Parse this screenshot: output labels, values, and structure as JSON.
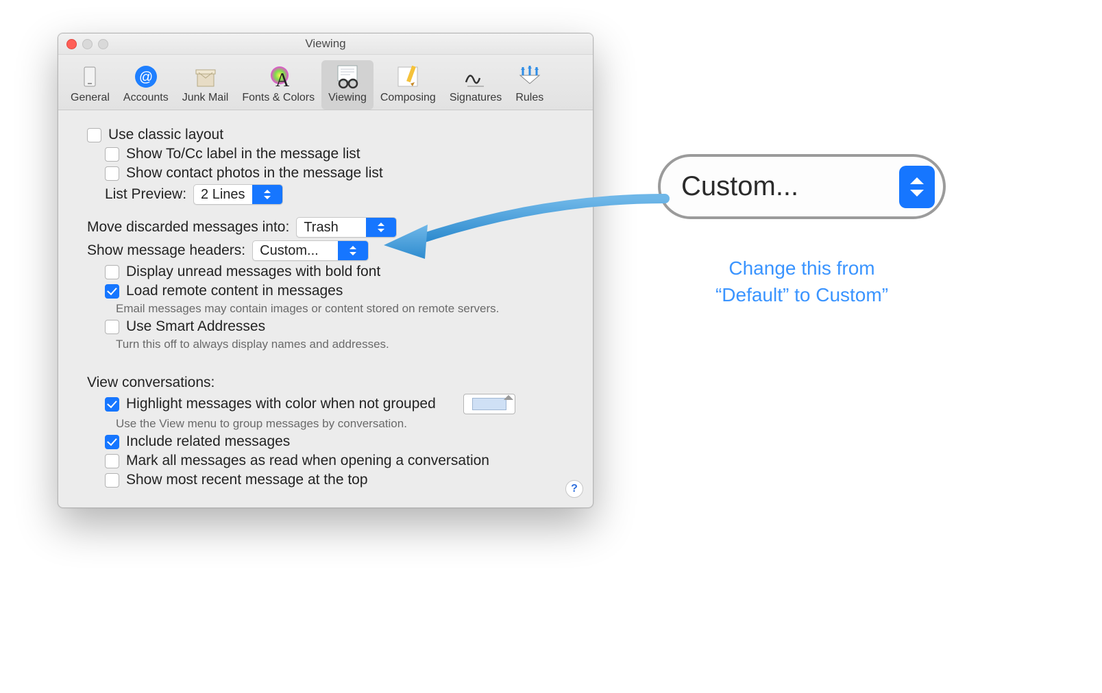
{
  "window": {
    "title": "Viewing",
    "tabs": [
      "General",
      "Accounts",
      "Junk Mail",
      "Fonts & Colors",
      "Viewing",
      "Composing",
      "Signatures",
      "Rules"
    ],
    "selected_tab": "Viewing"
  },
  "options": {
    "use_classic_layout": "Use classic layout",
    "show_tocc_label": "Show To/Cc label in the message list",
    "show_contact_photos": "Show contact photos in the message list",
    "list_preview_label": "List Preview:",
    "list_preview_value": "2 Lines",
    "move_discarded_label": "Move discarded messages into:",
    "move_discarded_value": "Trash",
    "show_headers_label": "Show message headers:",
    "show_headers_value": "Custom...",
    "display_unread_bold": "Display unread messages with bold font",
    "load_remote": "Load remote content in messages",
    "load_remote_hint": "Email messages may contain images or content stored on remote servers.",
    "use_smart_addresses": "Use Smart Addresses",
    "use_smart_addresses_hint": "Turn this off to always display names and addresses.",
    "view_conversations_label": "View conversations:",
    "highlight_color": "Highlight messages with color when not grouped",
    "highlight_color_hint": "Use the View menu to group messages by conversation.",
    "include_related": "Include related messages",
    "mark_all_read": "Mark all messages as read when opening a conversation",
    "show_recent_top": "Show most recent message at the top"
  },
  "callout": {
    "value": "Custom...",
    "line1": "Change this from",
    "line2": "“Default” to Custom”"
  }
}
